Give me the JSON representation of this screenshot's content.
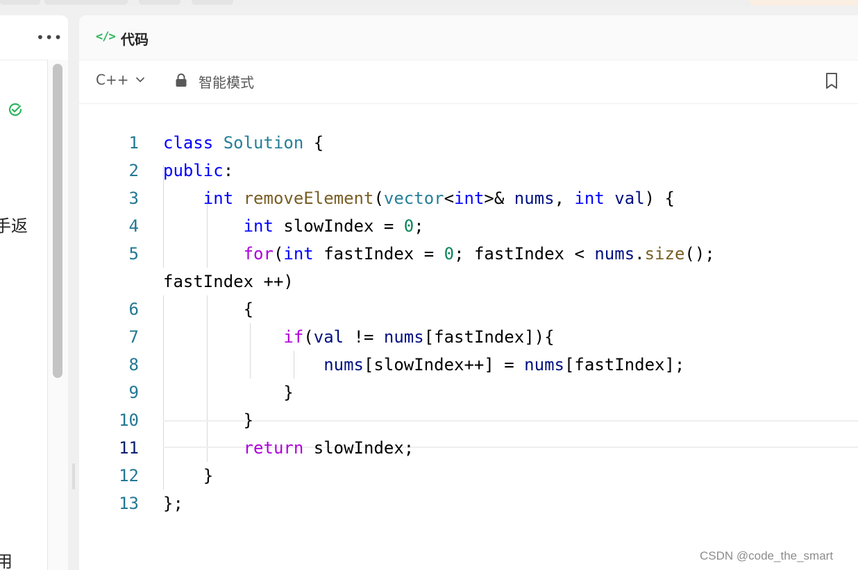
{
  "left_panel": {
    "more_glyph": "•••",
    "fragment_1": "手返",
    "fragment_2": "用"
  },
  "code_panel": {
    "title": "代码",
    "icon_text": "</>",
    "language": "C++",
    "mode": "智能模式"
  },
  "editor": {
    "active_line": 11,
    "lines": [
      {
        "no": "1",
        "text": "class Solution {"
      },
      {
        "no": "2",
        "text": "public:"
      },
      {
        "no": "3",
        "text": "    int removeElement(vector<int>& nums, int val) {"
      },
      {
        "no": "4",
        "text": "        int slowIndex = 0;"
      },
      {
        "no": "5",
        "text": "        for(int fastIndex = 0; fastIndex < nums.size();"
      },
      {
        "no": "",
        "text": "fastIndex ++)"
      },
      {
        "no": "6",
        "text": "        {"
      },
      {
        "no": "7",
        "text": "            if(val != nums[fastIndex]){"
      },
      {
        "no": "8",
        "text": "                nums[slowIndex++] = nums[fastIndex];"
      },
      {
        "no": "9",
        "text": "            }"
      },
      {
        "no": "10",
        "text": "        }"
      },
      {
        "no": "11",
        "text": "        return slowIndex;"
      },
      {
        "no": "12",
        "text": "    }"
      },
      {
        "no": "13",
        "text": "};"
      }
    ]
  },
  "watermark": "CSDN @code_the_smart",
  "colors": {
    "keyword": "#0000ff",
    "control": "#af00db",
    "type": "#267f99",
    "function": "#795e26",
    "variable": "#001080",
    "number": "#098658",
    "line_number": "#237893",
    "accent_green": "#2db55d"
  }
}
